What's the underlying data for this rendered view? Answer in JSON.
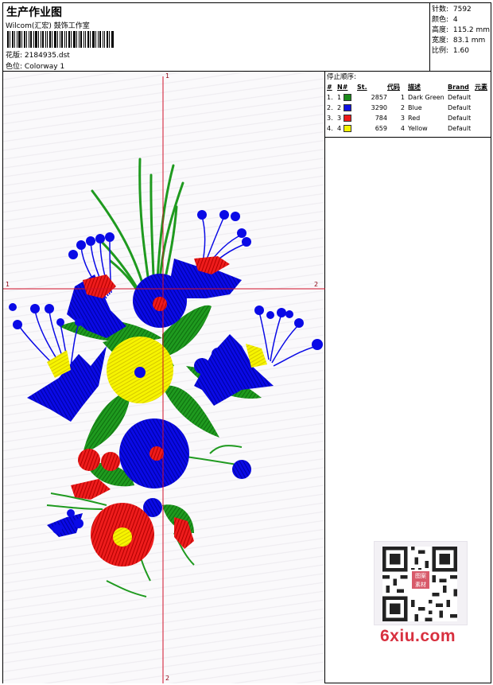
{
  "header": {
    "title": "生产作业图",
    "company": "Wilcom(汇宏) 鼓饰工作室",
    "design_label": "花版:",
    "design_value": "2184935.dst",
    "colorway_label": "色位:",
    "colorway_value": "Colorway 1"
  },
  "stats": [
    {
      "label": "针数:",
      "value": "7592"
    },
    {
      "label": "颜色:",
      "value": "4"
    },
    {
      "label": "高度:",
      "value": "115.2 mm"
    },
    {
      "label": "宽度:",
      "value": "83.1 mm"
    },
    {
      "label": "比例:",
      "value": "1.60"
    }
  ],
  "stop_sequence": {
    "title": "停止顺序:",
    "columns": [
      "#",
      "N#",
      "St.",
      "代码",
      "描述",
      "Brand",
      "元素"
    ],
    "rows": [
      {
        "seq": "1.",
        "n": "1",
        "color": "#1b8a1b",
        "stitches": "2857",
        "code": "1",
        "desc": "Dark Green",
        "brand": "Default"
      },
      {
        "seq": "2.",
        "n": "2",
        "color": "#1010e0",
        "stitches": "3290",
        "code": "2",
        "desc": "Blue",
        "brand": "Default"
      },
      {
        "seq": "3.",
        "n": "3",
        "color": "#ee1a1a",
        "stitches": "784",
        "code": "3",
        "desc": "Red",
        "brand": "Default"
      },
      {
        "seq": "4.",
        "n": "4",
        "color": "#f4f400",
        "stitches": "659",
        "code": "4",
        "desc": "Yellow",
        "brand": "Default"
      }
    ]
  },
  "crosshair_labels": {
    "top": "1",
    "bottom": "2",
    "left": "1",
    "right": "2"
  },
  "watermark": {
    "site": "6xiu.com",
    "seal": "图案 素材"
  },
  "colors": {
    "green": "#1f9a1f",
    "blue": "#0a0ae6",
    "red": "#ee1c1c",
    "yellow": "#f6f400",
    "crosshair": "#d0102a"
  }
}
